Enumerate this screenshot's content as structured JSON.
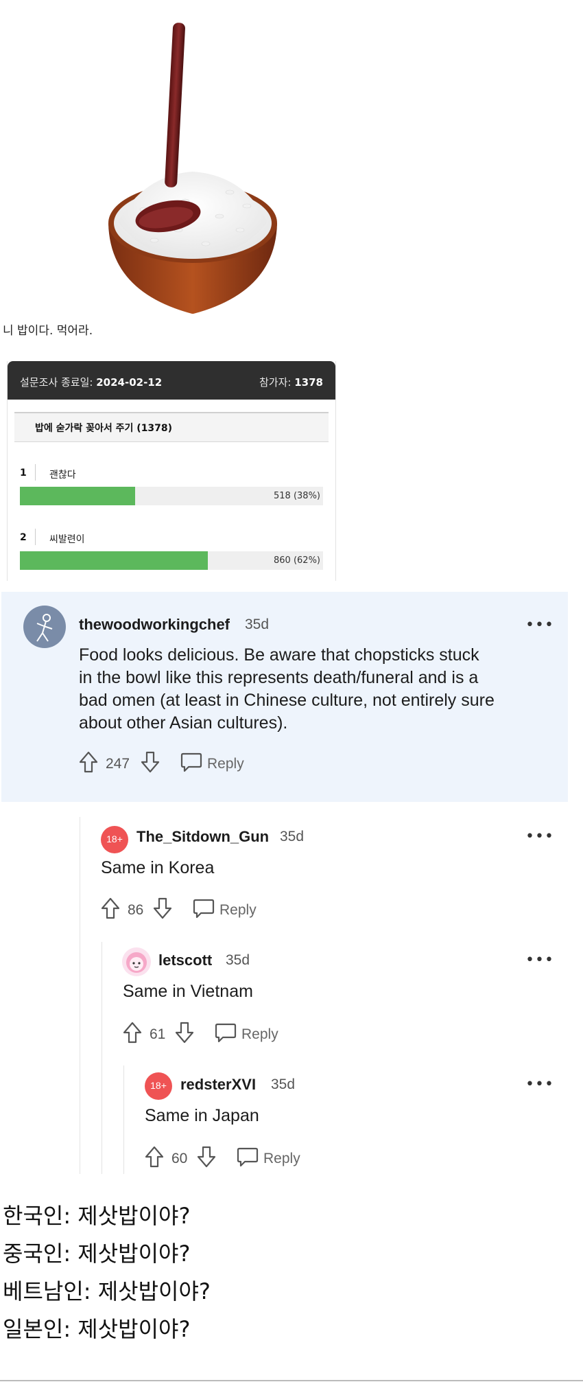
{
  "caption": "니 밥이다. 먹어라.",
  "poll": {
    "end_label": "설문조사 종료일:",
    "end_date": "2024-02-12",
    "participants_label": "참가자:",
    "participants": "1378",
    "question": "밥에 숟가락 꽂아서 주기 (1378)",
    "options": [
      {
        "num": "1",
        "label": "괜찮다",
        "count_text": "518 (38%)",
        "percent": 38
      },
      {
        "num": "2",
        "label": "씨발련이",
        "count_text": "860 (62%)",
        "percent": 62
      }
    ],
    "bar_color": "#5cb85c"
  },
  "comments": [
    {
      "username": "thewoodworkingchef",
      "age": "35d",
      "more": "•••",
      "lines": [
        "Food looks delicious. Be aware that chopsticks stuck",
        "in the bowl like this represents death/funeral and is a",
        "bad omen (at least in Chinese culture, not entirely sure",
        "about other Asian cultures)."
      ],
      "score": "247",
      "reply": "Reply"
    },
    {
      "username": "The_Sitdown_Gun",
      "age": "35d",
      "more": "•••",
      "text": "Same in Korea",
      "score": "86",
      "reply": "Reply"
    },
    {
      "username": "letscott",
      "age": "35d",
      "more": "•••",
      "text": "Same in Vietnam",
      "score": "61",
      "reply": "Reply"
    },
    {
      "username": "redsterXVI",
      "age": "35d",
      "more": "•••",
      "text": "Same in Japan",
      "score": "60",
      "reply": "Reply"
    }
  ],
  "badge_18": "18+",
  "highlight_bg": "#eef4fc",
  "jokes": [
    "한국인: 제삿밥이야?",
    "중국인:  제삿밥이야?",
    "베트남인: 제삿밥이야?",
    "일본인: 제삿밥이야?"
  ]
}
